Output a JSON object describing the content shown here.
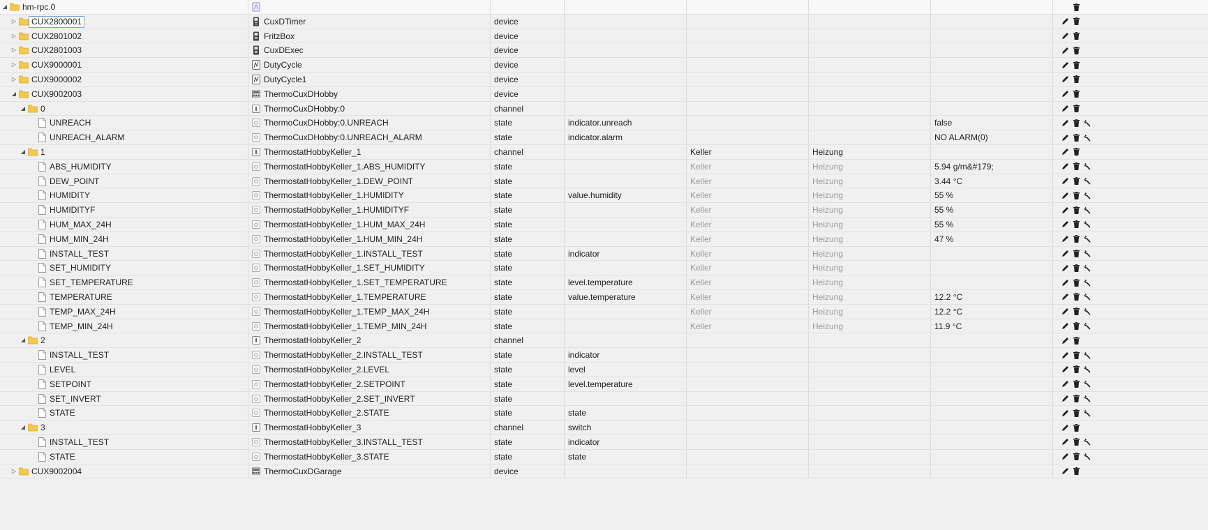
{
  "colors": {
    "folder": "#f2c94c",
    "folder_dark": "#d9a62c",
    "border": "#dcdcdc",
    "dim_text": "#9a9a9a"
  },
  "rows": [
    {
      "depth": 0,
      "toggle": "expanded",
      "icon": "folder",
      "name": "hm-rpc.0",
      "title": "",
      "title_icon": "adapter-icon",
      "type": "",
      "role": "",
      "room": "",
      "func": "",
      "value": "",
      "actions": [
        "delete"
      ]
    },
    {
      "depth": 1,
      "toggle": "collapsed",
      "icon": "folder",
      "name": "CUX2800001",
      "selected": true,
      "title": "CuxDTimer",
      "title_icon": "device-icon",
      "type": "device",
      "role": "",
      "room": "",
      "func": "",
      "value": "",
      "actions": [
        "edit",
        "delete"
      ]
    },
    {
      "depth": 1,
      "toggle": "collapsed",
      "icon": "folder",
      "name": "CUX2801002",
      "title": "FritzBox",
      "title_icon": "device-icon",
      "type": "device",
      "role": "",
      "room": "",
      "func": "",
      "value": "",
      "actions": [
        "edit",
        "delete"
      ]
    },
    {
      "depth": 1,
      "toggle": "collapsed",
      "icon": "folder",
      "name": "CUX2801003",
      "title": "CuxDExec",
      "title_icon": "device-icon",
      "type": "device",
      "role": "",
      "room": "",
      "func": "",
      "value": "",
      "actions": [
        "edit",
        "delete"
      ]
    },
    {
      "depth": 1,
      "toggle": "collapsed",
      "icon": "folder",
      "name": "CUX9000001",
      "title": "DutyCycle",
      "title_icon": "dutycycle-icon",
      "type": "device",
      "role": "",
      "room": "",
      "func": "",
      "value": "",
      "actions": [
        "edit",
        "delete"
      ]
    },
    {
      "depth": 1,
      "toggle": "collapsed",
      "icon": "folder",
      "name": "CUX9000002",
      "title": "DutyCycle1",
      "title_icon": "dutycycle-icon",
      "type": "device",
      "role": "",
      "room": "",
      "func": "",
      "value": "",
      "actions": [
        "edit",
        "delete"
      ]
    },
    {
      "depth": 1,
      "toggle": "expanded",
      "icon": "folder",
      "name": "CUX9002003",
      "title": "ThermoCuxDHobby",
      "title_icon": "thermo-device-icon",
      "type": "device",
      "role": "",
      "room": "",
      "func": "",
      "value": "",
      "actions": [
        "edit",
        "delete"
      ]
    },
    {
      "depth": 2,
      "toggle": "expanded",
      "icon": "folder",
      "name": "0",
      "title": "ThermoCuxDHobby:0",
      "title_icon": "channel-icon",
      "type": "channel",
      "role": "",
      "room": "",
      "func": "",
      "value": "",
      "actions": [
        "edit",
        "delete"
      ]
    },
    {
      "depth": 3,
      "toggle": "none",
      "icon": "file",
      "name": "UNREACH",
      "title": "ThermoCuxDHobby:0.UNREACH",
      "title_icon": "state-icon",
      "type": "state",
      "role": "indicator.unreach",
      "room": "",
      "func": "",
      "value": "false",
      "actions": [
        "edit",
        "delete",
        "wrench"
      ]
    },
    {
      "depth": 3,
      "toggle": "none",
      "icon": "file",
      "name": "UNREACH_ALARM",
      "title": "ThermoCuxDHobby:0.UNREACH_ALARM",
      "title_icon": "state-icon",
      "type": "state",
      "role": "indicator.alarm",
      "room": "",
      "func": "",
      "value": "NO ALARM(0)",
      "actions": [
        "edit",
        "delete",
        "wrench"
      ]
    },
    {
      "depth": 2,
      "toggle": "expanded",
      "icon": "folder",
      "name": "1",
      "title": "ThermostatHobbyKeller_1",
      "title_icon": "channel-icon",
      "type": "channel",
      "role": "",
      "room": "Keller",
      "func": "Heizung",
      "value": "",
      "room_dim": false,
      "actions": [
        "edit",
        "delete"
      ]
    },
    {
      "depth": 3,
      "toggle": "none",
      "icon": "file",
      "name": "ABS_HUMIDITY",
      "title": "ThermostatHobbyKeller_1.ABS_HUMIDITY",
      "title_icon": "state-icon",
      "type": "state",
      "role": "",
      "room": "Keller",
      "func": "Heizung",
      "value": "5.94 g/m&#179;",
      "room_dim": true,
      "actions": [
        "edit",
        "delete",
        "wrench"
      ]
    },
    {
      "depth": 3,
      "toggle": "none",
      "icon": "file",
      "name": "DEW_POINT",
      "title": "ThermostatHobbyKeller_1.DEW_POINT",
      "title_icon": "state-icon",
      "type": "state",
      "role": "",
      "room": "Keller",
      "func": "Heizung",
      "value": "3.44 °C",
      "room_dim": true,
      "actions": [
        "edit",
        "delete",
        "wrench"
      ]
    },
    {
      "depth": 3,
      "toggle": "none",
      "icon": "file",
      "name": "HUMIDITY",
      "title": "ThermostatHobbyKeller_1.HUMIDITY",
      "title_icon": "state-icon",
      "type": "state",
      "role": "value.humidity",
      "room": "Keller",
      "func": "Heizung",
      "value": "55 %",
      "room_dim": true,
      "actions": [
        "edit",
        "delete",
        "wrench"
      ]
    },
    {
      "depth": 3,
      "toggle": "none",
      "icon": "file",
      "name": "HUMIDITYF",
      "title": "ThermostatHobbyKeller_1.HUMIDITYF",
      "title_icon": "state-icon",
      "type": "state",
      "role": "",
      "room": "Keller",
      "func": "Heizung",
      "value": "55 %",
      "room_dim": true,
      "actions": [
        "edit",
        "delete",
        "wrench"
      ]
    },
    {
      "depth": 3,
      "toggle": "none",
      "icon": "file",
      "name": "HUM_MAX_24H",
      "title": "ThermostatHobbyKeller_1.HUM_MAX_24H",
      "title_icon": "state-icon",
      "type": "state",
      "role": "",
      "room": "Keller",
      "func": "Heizung",
      "value": "55 %",
      "room_dim": true,
      "actions": [
        "edit",
        "delete",
        "wrench"
      ]
    },
    {
      "depth": 3,
      "toggle": "none",
      "icon": "file",
      "name": "HUM_MIN_24H",
      "title": "ThermostatHobbyKeller_1.HUM_MIN_24H",
      "title_icon": "state-icon",
      "type": "state",
      "role": "",
      "room": "Keller",
      "func": "Heizung",
      "value": "47 %",
      "room_dim": true,
      "actions": [
        "edit",
        "delete",
        "wrench"
      ]
    },
    {
      "depth": 3,
      "toggle": "none",
      "icon": "file",
      "name": "INSTALL_TEST",
      "title": "ThermostatHobbyKeller_1.INSTALL_TEST",
      "title_icon": "state-icon",
      "type": "state",
      "role": "indicator",
      "room": "Keller",
      "func": "Heizung",
      "value": "",
      "room_dim": true,
      "actions": [
        "edit",
        "delete",
        "wrench"
      ]
    },
    {
      "depth": 3,
      "toggle": "none",
      "icon": "file",
      "name": "SET_HUMIDITY",
      "title": "ThermostatHobbyKeller_1.SET_HUMIDITY",
      "title_icon": "state-icon",
      "type": "state",
      "role": "",
      "room": "Keller",
      "func": "Heizung",
      "value": "",
      "room_dim": true,
      "actions": [
        "edit",
        "delete",
        "wrench"
      ]
    },
    {
      "depth": 3,
      "toggle": "none",
      "icon": "file",
      "name": "SET_TEMPERATURE",
      "title": "ThermostatHobbyKeller_1.SET_TEMPERATURE",
      "title_icon": "state-icon",
      "type": "state",
      "role": "level.temperature",
      "room": "Keller",
      "func": "Heizung",
      "value": "",
      "room_dim": true,
      "actions": [
        "edit",
        "delete",
        "wrench"
      ]
    },
    {
      "depth": 3,
      "toggle": "none",
      "icon": "file",
      "name": "TEMPERATURE",
      "title": "ThermostatHobbyKeller_1.TEMPERATURE",
      "title_icon": "state-icon",
      "type": "state",
      "role": "value.temperature",
      "room": "Keller",
      "func": "Heizung",
      "value": "12.2 °C",
      "room_dim": true,
      "actions": [
        "edit",
        "delete",
        "wrench"
      ]
    },
    {
      "depth": 3,
      "toggle": "none",
      "icon": "file",
      "name": "TEMP_MAX_24H",
      "title": "ThermostatHobbyKeller_1.TEMP_MAX_24H",
      "title_icon": "state-icon",
      "type": "state",
      "role": "",
      "room": "Keller",
      "func": "Heizung",
      "value": "12.2 °C",
      "room_dim": true,
      "actions": [
        "edit",
        "delete",
        "wrench"
      ]
    },
    {
      "depth": 3,
      "toggle": "none",
      "icon": "file",
      "name": "TEMP_MIN_24H",
      "title": "ThermostatHobbyKeller_1.TEMP_MIN_24H",
      "title_icon": "state-icon",
      "type": "state",
      "role": "",
      "room": "Keller",
      "func": "Heizung",
      "value": "11.9 °C",
      "room_dim": true,
      "actions": [
        "edit",
        "delete",
        "wrench"
      ]
    },
    {
      "depth": 2,
      "toggle": "expanded",
      "icon": "folder",
      "name": "2",
      "title": "ThermostatHobbyKeller_2",
      "title_icon": "channel-icon",
      "type": "channel",
      "role": "",
      "room": "",
      "func": "",
      "value": "",
      "actions": [
        "edit",
        "delete"
      ]
    },
    {
      "depth": 3,
      "toggle": "none",
      "icon": "file",
      "name": "INSTALL_TEST",
      "title": "ThermostatHobbyKeller_2.INSTALL_TEST",
      "title_icon": "state-icon",
      "type": "state",
      "role": "indicator",
      "room": "",
      "func": "",
      "value": "",
      "actions": [
        "edit",
        "delete",
        "wrench"
      ]
    },
    {
      "depth": 3,
      "toggle": "none",
      "icon": "file",
      "name": "LEVEL",
      "title": "ThermostatHobbyKeller_2.LEVEL",
      "title_icon": "state-icon",
      "type": "state",
      "role": "level",
      "room": "",
      "func": "",
      "value": "",
      "actions": [
        "edit",
        "delete",
        "wrench"
      ]
    },
    {
      "depth": 3,
      "toggle": "none",
      "icon": "file",
      "name": "SETPOINT",
      "title": "ThermostatHobbyKeller_2.SETPOINT",
      "title_icon": "state-icon",
      "type": "state",
      "role": "level.temperature",
      "room": "",
      "func": "",
      "value": "",
      "actions": [
        "edit",
        "delete",
        "wrench"
      ]
    },
    {
      "depth": 3,
      "toggle": "none",
      "icon": "file",
      "name": "SET_INVERT",
      "title": "ThermostatHobbyKeller_2.SET_INVERT",
      "title_icon": "state-icon",
      "type": "state",
      "role": "",
      "room": "",
      "func": "",
      "value": "",
      "actions": [
        "edit",
        "delete",
        "wrench"
      ]
    },
    {
      "depth": 3,
      "toggle": "none",
      "icon": "file",
      "name": "STATE",
      "title": "ThermostatHobbyKeller_2.STATE",
      "title_icon": "state-icon",
      "type": "state",
      "role": "state",
      "room": "",
      "func": "",
      "value": "",
      "actions": [
        "edit",
        "delete",
        "wrench"
      ]
    },
    {
      "depth": 2,
      "toggle": "expanded",
      "icon": "folder",
      "name": "3",
      "title": "ThermostatHobbyKeller_3",
      "title_icon": "channel-icon",
      "type": "channel",
      "role": "switch",
      "room": "",
      "func": "",
      "value": "",
      "actions": [
        "edit",
        "delete"
      ]
    },
    {
      "depth": 3,
      "toggle": "none",
      "icon": "file",
      "name": "INSTALL_TEST",
      "title": "ThermostatHobbyKeller_3.INSTALL_TEST",
      "title_icon": "state-icon",
      "type": "state",
      "role": "indicator",
      "room": "",
      "func": "",
      "value": "",
      "actions": [
        "edit",
        "delete",
        "wrench"
      ]
    },
    {
      "depth": 3,
      "toggle": "none",
      "icon": "file",
      "name": "STATE",
      "title": "ThermostatHobbyKeller_3.STATE",
      "title_icon": "state-icon",
      "type": "state",
      "role": "state",
      "room": "",
      "func": "",
      "value": "",
      "actions": [
        "edit",
        "delete",
        "wrench"
      ]
    },
    {
      "depth": 1,
      "toggle": "collapsed",
      "icon": "folder",
      "name": "CUX9002004",
      "title": "ThermoCuxDGarage",
      "title_icon": "thermo-device-icon",
      "type": "device",
      "role": "",
      "room": "",
      "func": "",
      "value": "",
      "actions": [
        "edit",
        "delete"
      ]
    }
  ]
}
